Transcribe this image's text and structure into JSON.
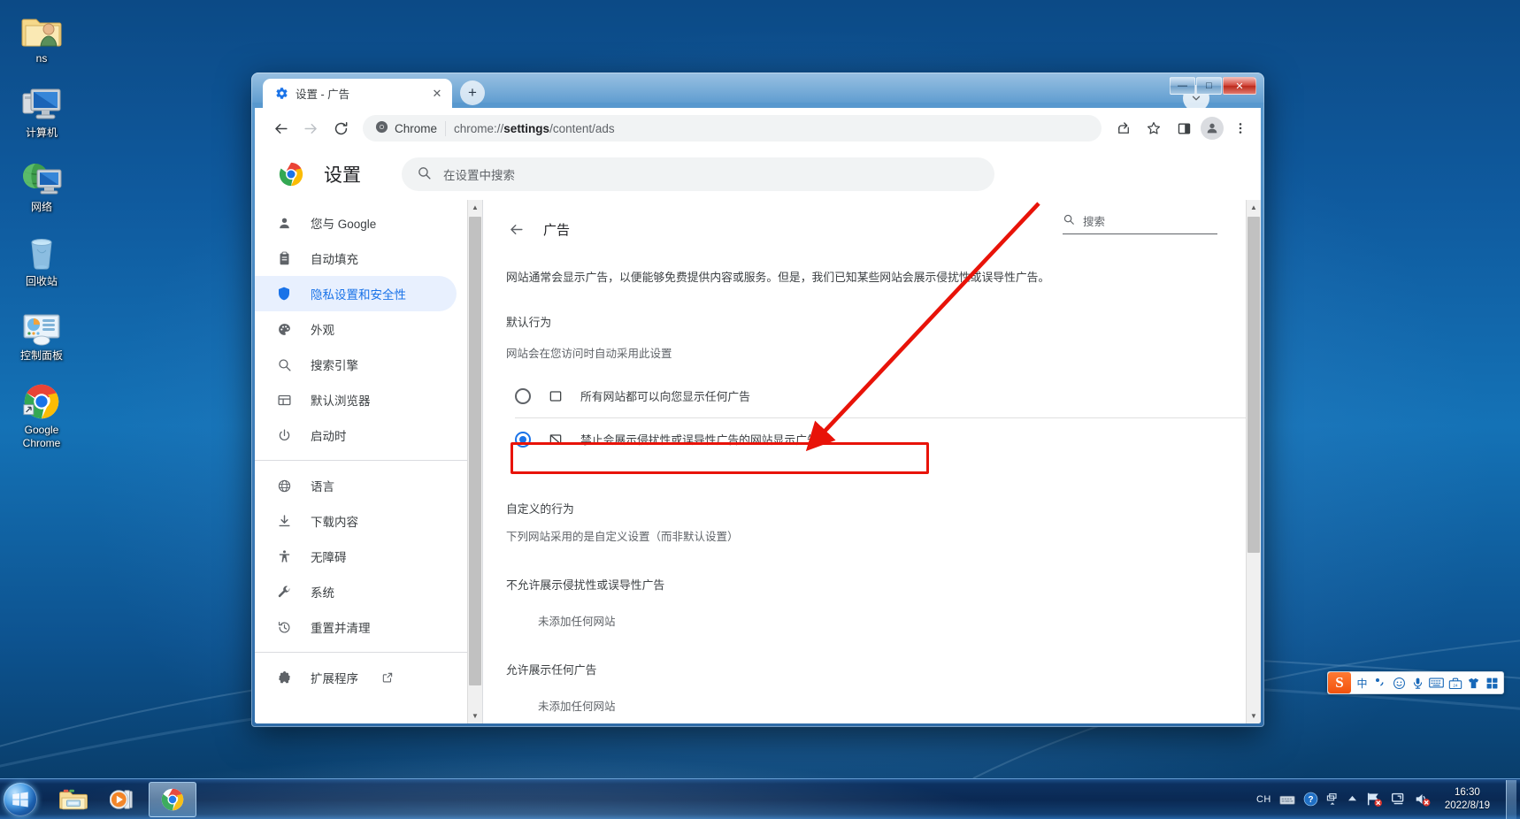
{
  "desktop": {
    "icons": [
      {
        "label": "ns",
        "icon": "user-folder-icon"
      },
      {
        "label": "计算机",
        "icon": "computer-icon"
      },
      {
        "label": "网络",
        "icon": "network-icon"
      },
      {
        "label": "回收站",
        "icon": "recycle-bin-icon"
      },
      {
        "label": "控制面板",
        "icon": "control-panel-icon"
      },
      {
        "label": "Google\nChrome",
        "icon": "chrome-icon"
      }
    ]
  },
  "window": {
    "controls": {
      "minimize": "—",
      "maximize": "□",
      "close": "✕"
    }
  },
  "browser": {
    "tab": {
      "title": "设置 - 广告",
      "favicon": "settings-gear-icon",
      "close": "✕"
    },
    "new_tab": "+",
    "nav": {
      "back": "←",
      "forward": "→",
      "reload": "↻"
    },
    "omnibox": {
      "chip_label": "Chrome",
      "url_prefix": "chrome://",
      "url_bold": "settings",
      "url_suffix": "/content/ads",
      "full_url": "chrome://settings/content/ads"
    },
    "actions": {
      "share": "share-icon",
      "bookmark": "star-icon",
      "sidepanel": "side-panel-icon",
      "profile": "avatar-icon",
      "menu": "three-dot-menu-icon"
    }
  },
  "settings": {
    "logo": "chrome-logo-icon",
    "title": "设置",
    "search_placeholder": "在设置中搜索",
    "sidebar": {
      "group1": [
        {
          "label": "您与 Google",
          "icon": "person-icon",
          "active": false
        },
        {
          "label": "自动填充",
          "icon": "clipboard-icon",
          "active": false
        },
        {
          "label": "隐私设置和安全性",
          "icon": "shield-icon",
          "active": true
        },
        {
          "label": "外观",
          "icon": "palette-icon",
          "active": false
        },
        {
          "label": "搜索引擎",
          "icon": "search-icon",
          "active": false
        },
        {
          "label": "默认浏览器",
          "icon": "browser-window-icon",
          "active": false
        },
        {
          "label": "启动时",
          "icon": "power-icon",
          "active": false
        }
      ],
      "group2": [
        {
          "label": "语言",
          "icon": "globe-icon",
          "active": false
        },
        {
          "label": "下载内容",
          "icon": "download-icon",
          "active": false
        },
        {
          "label": "无障碍",
          "icon": "accessibility-icon",
          "active": false
        },
        {
          "label": "系统",
          "icon": "wrench-icon",
          "active": false
        },
        {
          "label": "重置并清理",
          "icon": "history-restore-icon",
          "active": false
        }
      ],
      "extensions": {
        "label": "扩展程序",
        "icon": "puzzle-icon",
        "external": "open-in-new-icon"
      }
    },
    "content": {
      "back": "←",
      "title": "广告",
      "search_label": "搜索",
      "description": "网站通常会显示广告，以便能够免费提供内容或服务。但是，我们已知某些网站会展示侵扰性或误导性广告。",
      "default_behavior_heading": "默认行为",
      "default_behavior_sub": "网站会在您访问时自动采用此设置",
      "options": [
        {
          "label": "所有网站都可以向您显示任何广告",
          "icon": "ad-allow-icon",
          "selected": false
        },
        {
          "label": "禁止会展示侵扰性或误导性广告的网站显示广告",
          "icon": "ad-block-icon",
          "selected": true
        }
      ],
      "custom_heading": "自定义的行为",
      "custom_sub": "下列网站采用的是自定义设置（而非默认设置）",
      "block_group_label": "不允许展示侵扰性或误导性广告",
      "block_group_empty": "未添加任何网站",
      "allow_group_label": "允许展示任何广告",
      "allow_group_empty": "未添加任何网站"
    }
  },
  "annotation": {
    "highlight_color": "#e81309",
    "arrow_color": "#e81309"
  },
  "ime": {
    "logo": "S",
    "items": [
      {
        "icon": "chinese-mode-icon",
        "glyph": "中"
      },
      {
        "icon": "punctuation-icon",
        "glyph": "°,"
      },
      {
        "icon": "smiley-icon",
        "glyph": "☺"
      },
      {
        "icon": "microphone-icon",
        "glyph": "⬤"
      },
      {
        "icon": "keyboard-icon",
        "glyph": "⌨"
      },
      {
        "icon": "toolbox-icon",
        "glyph": "24"
      },
      {
        "icon": "skin-icon",
        "glyph": "⬤"
      },
      {
        "icon": "apps-grid-icon",
        "glyph": "⬛"
      }
    ]
  },
  "taskbar": {
    "start": "start-orb-icon",
    "quick_launch": [
      {
        "icon": "explorer-icon",
        "active": false
      },
      {
        "icon": "media-player-icon",
        "active": false
      },
      {
        "icon": "chrome-icon",
        "active": true
      }
    ],
    "tray": {
      "language": "CH",
      "icons": [
        "keyboard-tray-icon",
        "help-tray-icon",
        "monitor-tray-icon",
        "show-hidden-icon",
        "network-error-icon",
        "action-center-icon",
        "volume-mute-icon"
      ],
      "time": "16:30",
      "date": "2022/8/19"
    }
  }
}
